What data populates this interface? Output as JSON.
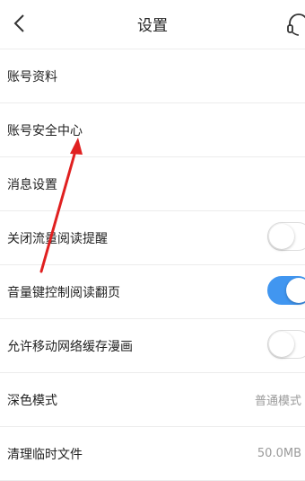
{
  "header": {
    "title": "设置",
    "back_icon": "chevron-left-icon",
    "support_icon": "headset-icon"
  },
  "settings": [
    {
      "label": "账号资料"
    },
    {
      "label": "账号安全中心"
    },
    {
      "label": "消息设置"
    },
    {
      "label": "关闭流量阅读提醒",
      "toggle": "off"
    },
    {
      "label": "音量键控制阅读翻页",
      "toggle": "on"
    },
    {
      "label": "允许移动网络缓存漫画",
      "toggle": "off"
    },
    {
      "label": "深色模式",
      "value": "普通模式"
    },
    {
      "label": "清理临时文件",
      "value": "50.0MB"
    }
  ],
  "colors": {
    "toggle_on": "#4196f0",
    "annotation_arrow": "#e02020",
    "secondary_text": "#9a9a9a"
  },
  "annotation": {
    "icon": "red-arrow-annotation"
  }
}
